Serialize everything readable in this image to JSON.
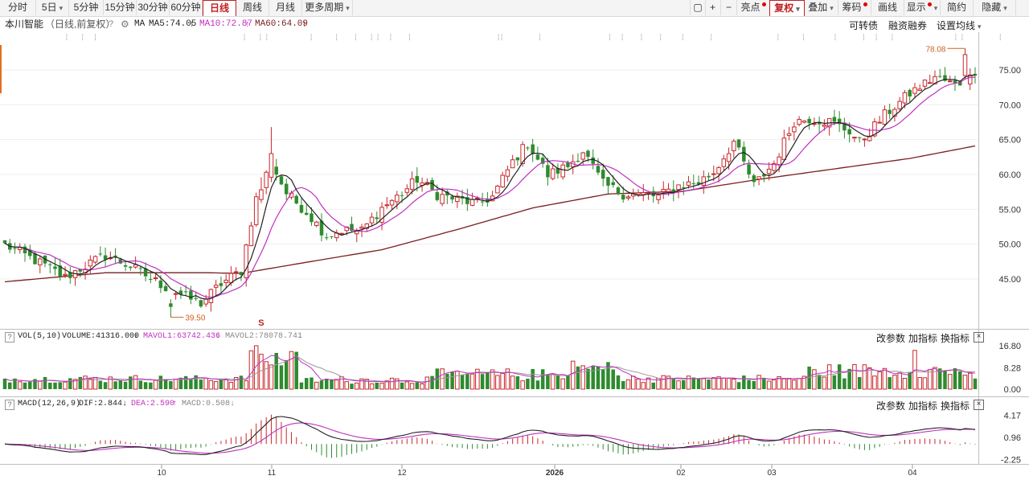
{
  "toolbar": {
    "left": [
      "分时",
      "5日",
      "5分钟",
      "15分钟",
      "30分钟",
      "60分钟",
      "日线",
      "周线",
      "月线",
      "更多周期"
    ],
    "active": "日线",
    "right": [
      "亮点",
      "复权",
      "叠加",
      "筹码",
      "画线",
      "显示",
      "简约",
      "隐藏"
    ]
  },
  "info": {
    "stock": "本川智能",
    "mode": "（日线,前复权）",
    "ma_label": "MA",
    "ma5": "MA5:74.05",
    "ma10": "MA10:72.87",
    "ma60": "MA60:64.09",
    "convertible": "可转债",
    "margin": "融资融券",
    "ma_settings": "设置均线"
  },
  "colors": {
    "up": "#c8282c",
    "down": "#2e8b2e",
    "ma5": "#222222",
    "ma10": "#c030c0",
    "ma60": "#7a1e1e",
    "mavol2": "#999999"
  },
  "chart_data": [
    {
      "type": "candlestick",
      "title": "本川智能（日线,前复权）",
      "y_ticks": [
        45.0,
        50.0,
        55.0,
        60.0,
        65.0,
        70.0,
        75.0
      ],
      "ylim": [
        41,
        81
      ],
      "x_ticks": [
        "10",
        "11",
        "12",
        "2026",
        "02",
        "03",
        "04"
      ],
      "annotations": {
        "high": "78.08",
        "low": "39.50",
        "marker": "S"
      },
      "anchors": [
        [
          0,
          49.9
        ],
        [
          8,
          46.9
        ],
        [
          12,
          45.2
        ],
        [
          15,
          46.5
        ],
        [
          20,
          48.4
        ],
        [
          25,
          46.8
        ],
        [
          32,
          43.8
        ],
        [
          36,
          42.4
        ],
        [
          39,
          41.5
        ],
        [
          43,
          44.3
        ],
        [
          47,
          46.2
        ],
        [
          50,
          56.8
        ],
        [
          53,
          61.6
        ],
        [
          56,
          57.3
        ],
        [
          60,
          54.6
        ],
        [
          64,
          51.2
        ],
        [
          67,
          52.0
        ],
        [
          71,
          51.9
        ],
        [
          75,
          55.2
        ],
        [
          79,
          57.3
        ],
        [
          82,
          59.3
        ],
        [
          86,
          57.1
        ],
        [
          90,
          56.4
        ],
        [
          94,
          55.8
        ],
        [
          97,
          56.8
        ],
        [
          101,
          61.8
        ],
        [
          104,
          64.5
        ],
        [
          108,
          59.9
        ],
        [
          112,
          61.2
        ],
        [
          115,
          63.4
        ],
        [
          119,
          58.6
        ],
        [
          123,
          57.2
        ],
        [
          127,
          57.1
        ],
        [
          130,
          56.8
        ],
        [
          134,
          58.4
        ],
        [
          138,
          58.9
        ],
        [
          141,
          60.3
        ],
        [
          145,
          64.7
        ],
        [
          149,
          58.4
        ],
        [
          153,
          61.6
        ],
        [
          157,
          67.6
        ],
        [
          160,
          68.0
        ],
        [
          164,
          67.6
        ],
        [
          168,
          66.2
        ],
        [
          170,
          64.6
        ],
        [
          175,
          68.5
        ],
        [
          180,
          71.6
        ],
        [
          185,
          74.0
        ],
        [
          189,
          72.8
        ],
        [
          193,
          74.2
        ]
      ],
      "ma60": [
        [
          0,
          44.6
        ],
        [
          20,
          45.9
        ],
        [
          40,
          45.9
        ],
        [
          47,
          45.8
        ],
        [
          60,
          47.4
        ],
        [
          75,
          49.2
        ],
        [
          90,
          52.1
        ],
        [
          105,
          55.2
        ],
        [
          120,
          57.2
        ],
        [
          135,
          57.6
        ],
        [
          150,
          59.3
        ],
        [
          165,
          60.8
        ],
        [
          180,
          62.3
        ],
        [
          193,
          64.1
        ]
      ],
      "series": [
        {
          "name": "MA5",
          "value": 74.05
        },
        {
          "name": "MA10",
          "value": 72.87
        },
        {
          "name": "MA60",
          "value": 64.09
        }
      ]
    },
    {
      "type": "bar",
      "title": "VOL(5,10)",
      "y_ticks": [
        16.8,
        8.28,
        0.0
      ],
      "series": [
        {
          "name": "VOLUME",
          "value": 41316.0
        },
        {
          "name": "MAVOL1",
          "value": 63742.436
        },
        {
          "name": "MAVOL2",
          "value": 78078.741
        }
      ]
    },
    {
      "type": "bar",
      "title": "MACD(12,26,9)",
      "y_ticks": [
        4.17,
        0.96,
        -2.25
      ],
      "series": [
        {
          "name": "DIF",
          "value": 2.844
        },
        {
          "name": "DEA",
          "value": 2.59
        },
        {
          "name": "MACD",
          "value": 0.508
        }
      ]
    }
  ],
  "panels": {
    "vol": {
      "title": "VOL(5,10)",
      "volume": "VOLUME:41316.000",
      "mavol1": "MAVOL1:63742.436",
      "mavol2": "MAVOL2:78078.741"
    },
    "macd": {
      "title": "MACD(12,26,9)",
      "dif": "DIF:2.844",
      "dea": "DEA:2.590",
      "macd": "MACD:0.508"
    },
    "buttons": {
      "params": "改参数",
      "add": "加指标",
      "swap": "换指标",
      "close": "×"
    }
  }
}
